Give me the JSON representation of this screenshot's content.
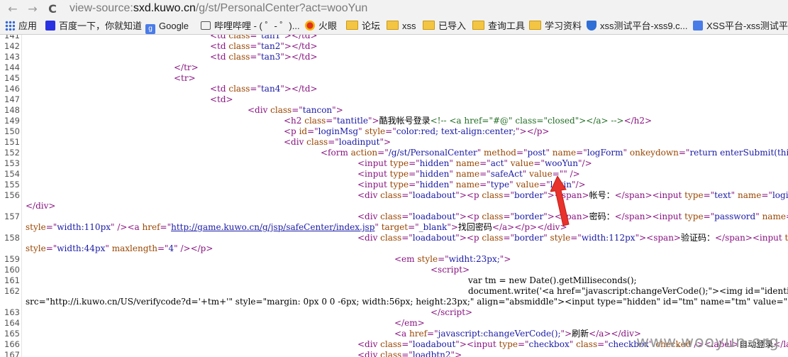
{
  "browser": {
    "url_scheme": "view-source:",
    "url_host": "sxd.kuwo.cn",
    "url_path": "/g/st/PersonalCenter?act=wooYun",
    "nav": {
      "back": "←",
      "forward": "→",
      "reload": "C"
    }
  },
  "bookmarks": [
    {
      "label": "应用",
      "icon": "apps-grid-icon"
    },
    {
      "label": "百度一下，你就知道",
      "icon": "baidu-icon"
    },
    {
      "label": "Google",
      "icon": "google-icon"
    },
    {
      "label": "哔哩哔哩 - ( ゜- ゜)...",
      "icon": "bilibili-icon"
    },
    {
      "label": "火眼",
      "icon": "huoyan-icon"
    },
    {
      "label": "论坛",
      "icon": "folder-icon"
    },
    {
      "label": "xss",
      "icon": "folder-icon"
    },
    {
      "label": "已导入",
      "icon": "folder-icon"
    },
    {
      "label": "查询工具",
      "icon": "folder-icon"
    },
    {
      "label": "学习资料",
      "icon": "folder-icon"
    },
    {
      "label": "xss测试平台-xss9.c...",
      "icon": "shield-icon"
    },
    {
      "label": "XSS平台-xss测试平",
      "icon": "xss-platform-icon"
    }
  ],
  "lines": [
    {
      "n": "141",
      "html": "<span class=\"t\">&lt;td </span><span class=\"a\">class</span><span class=\"t\">=\"</span><span class=\"v\">tan1</span><span class=\"t\">\"&gt;&lt;/td&gt;</span>"
    },
    {
      "n": "142",
      "html": "<span class=\"t\">&lt;td </span><span class=\"a\">class</span><span class=\"t\">=\"</span><span class=\"v\">tan2</span><span class=\"t\">\"&gt;&lt;/td&gt;</span>"
    },
    {
      "n": "143",
      "html": "<span class=\"t\">&lt;td </span><span class=\"a\">class</span><span class=\"t\">=\"</span><span class=\"v\">tan3</span><span class=\"t\">\"&gt;&lt;/td&gt;</span>"
    },
    {
      "n": "144",
      "html": "<span class=\"t\">&lt;/tr&gt;</span>"
    },
    {
      "n": "145",
      "html": "<span class=\"t\">&lt;tr&gt;</span>"
    },
    {
      "n": "146",
      "html": "<span class=\"t\">&lt;td </span><span class=\"a\">class</span><span class=\"t\">=\"</span><span class=\"v\">tan4</span><span class=\"t\">\"&gt;&lt;/td&gt;</span>"
    },
    {
      "n": "147",
      "html": "<span class=\"t\">&lt;td&gt;</span>"
    },
    {
      "n": "148",
      "html": "<span class=\"t\">&lt;div </span><span class=\"a\">class</span><span class=\"t\">=\"</span><span class=\"v\">tancon</span><span class=\"t\">\"&gt;</span>"
    },
    {
      "n": "149",
      "html": "<span class=\"t\">&lt;h2 </span><span class=\"a\">class</span><span class=\"t\">=\"</span><span class=\"v\">tantitle</span><span class=\"t\">\"&gt;</span>酷我帐号登录<span class=\"c\">&lt;!-- &lt;a href=\"#@\" class=\"closed\"&gt;&lt;/a&gt; --&gt;</span><span class=\"t\">&lt;/h2&gt;</span>"
    },
    {
      "n": "150",
      "html": "<span class=\"t\">&lt;p </span><span class=\"a\">id</span><span class=\"t\">=\"</span><span class=\"v\">loginMsg</span><span class=\"t\">\" </span><span class=\"a\">style</span><span class=\"t\">=\"</span><span class=\"v\">color:red; text-align:center;</span><span class=\"t\">\"&gt;&lt;/p&gt;</span>"
    },
    {
      "n": "151",
      "html": "<span class=\"t\">&lt;div </span><span class=\"a\">class</span><span class=\"t\">=\"</span><span class=\"v\">loadinput</span><span class=\"t\">\"&gt;</span>"
    },
    {
      "n": "152",
      "html": "<span class=\"t\">&lt;form </span><span class=\"a\">action</span><span class=\"t\">=\"</span><span class=\"v\">/g/st/PersonalCenter</span><span class=\"t\">\" </span><span class=\"a\">method</span><span class=\"t\">=\"</span><span class=\"v\">post</span><span class=\"t\">\" </span><span class=\"a\">name</span><span class=\"t\">=\"</span><span class=\"v\">logForm</span><span class=\"t\">\" </span><span class=\"a\">onkeydown</span><span class=\"t\">=\"</span><span class=\"v\">return enterSubmit(this, e</span>"
    },
    {
      "n": "153",
      "html": "<span class=\"t\">&lt;input </span><span class=\"a\">type</span><span class=\"t\">=\"</span><span class=\"v\">hidden</span><span class=\"t\">\" </span><span class=\"a\">name</span><span class=\"t\">=\"</span><span class=\"v\">act</span><span class=\"t\">\" </span><span class=\"a\">value</span><span class=\"t\">=\"</span><span class=\"v\">wooYun</span><span class=\"t\">\"/&gt;</span>"
    },
    {
      "n": "154",
      "html": "<span class=\"t\">&lt;input </span><span class=\"a\">type</span><span class=\"t\">=\"</span><span class=\"v\">hidden</span><span class=\"t\">\" </span><span class=\"a\">name</span><span class=\"t\">=\"</span><span class=\"v\">safeAct</span><span class=\"t\">\" </span><span class=\"a\">value</span><span class=\"t\">=\"\" /&gt;</span>"
    },
    {
      "n": "155",
      "html": "<span class=\"t\">&lt;input </span><span class=\"a\">type</span><span class=\"t\">=\"</span><span class=\"v\">hidden</span><span class=\"t\">\" </span><span class=\"a\">name</span><span class=\"t\">=\"</span><span class=\"v\">type</span><span class=\"t\">\" </span><span class=\"a\">value</span><span class=\"t\">=\"</span><span class=\"v\">login</span><span class=\"t\">\"/&gt;</span>"
    },
    {
      "n": "156",
      "html": "<span class=\"t\">&lt;div </span><span class=\"a\">class</span><span class=\"t\">=\"</span><span class=\"v\">loadabout</span><span class=\"t\">\"&gt;&lt;p </span><span class=\"a\">class</span><span class=\"t\">=\"</span><span class=\"v\">border</span><span class=\"t\">\"&gt;&lt;span&gt;</span>帐号：<span class=\"t\">&lt;/span&gt;&lt;input </span><span class=\"a\">type</span><span class=\"t\">=\"</span><span class=\"v\">text</span><span class=\"t\">\" </span><span class=\"a\">name</span><span class=\"t\">=\"</span><span class=\"v\">loginName</span>"
    },
    {
      "n": "",
      "html": "<span class=\"t\">&lt;/div&gt;</span>"
    },
    {
      "n": "157",
      "html": "<span class=\"t\">&lt;div </span><span class=\"a\">class</span><span class=\"t\">=\"</span><span class=\"v\">loadabout</span><span class=\"t\">\"&gt;&lt;p </span><span class=\"a\">class</span><span class=\"t\">=\"</span><span class=\"v\">border</span><span class=\"t\">\"&gt;&lt;span&gt;</span>密码：<span class=\"t\">&lt;/span&gt;&lt;input </span><span class=\"a\">type</span><span class=\"t\">=\"</span><span class=\"v\">password</span><span class=\"t\">\" </span><span class=\"a\">name</span><span class=\"t\">=\"</span><span class=\"v\">loginP</span>"
    },
    {
      "n": "",
      "html": "<span class=\"a\">style</span><span class=\"t\">=\"</span><span class=\"v\">width:110px</span><span class=\"t\">\" /&gt;&lt;a </span><span class=\"a\">href</span><span class=\"t\">=\"</span><span class=\"link\">http://game.kuwo.cn/g/jsp/safeCenter/index.jsp</span><span class=\"t\">\" </span><span class=\"a\">target</span><span class=\"t\">=\"</span><span class=\"v\">_blank</span><span class=\"t\">\"&gt;</span>找回密码<span class=\"t\">&lt;/a&gt;&lt;/p&gt;&lt;/div&gt;</span>"
    },
    {
      "n": "158",
      "html": "<span class=\"t\">&lt;div </span><span class=\"a\">class</span><span class=\"t\">=\"</span><span class=\"v\">loadabout</span><span class=\"t\">\"&gt;&lt;p </span><span class=\"a\">class</span><span class=\"t\">=\"</span><span class=\"v\">border</span><span class=\"t\">\" </span><span class=\"a\">style</span><span class=\"t\">=\"</span><span class=\"v\">width:112px</span><span class=\"t\">\"&gt;&lt;span&gt;</span>验证码：<span class=\"t\">&lt;/span&gt;&lt;input </span><span class=\"a\">type</span><span class=\"t\">=\"</span>"
    },
    {
      "n": "",
      "html": "<span class=\"a\">style</span><span class=\"t\">=\"</span><span class=\"v\">width:44px</span><span class=\"t\">\" </span><span class=\"a\">maxlength</span><span class=\"t\">=\"</span><span class=\"v\">4</span><span class=\"t\">\" /&gt;&lt;/p&gt;</span>"
    },
    {
      "n": "159",
      "html": "<span class=\"t\">&lt;em </span><span class=\"a\">style</span><span class=\"t\">=\"</span><span class=\"v\">widht:23px;</span><span class=\"t\">\"&gt;</span>"
    },
    {
      "n": "160",
      "html": "<span class=\"t\">&lt;script&gt;</span>"
    },
    {
      "n": "161",
      "html": "var tm = new Date().getMilliseconds();"
    },
    {
      "n": "162",
      "html": "document.write('&lt;a href=\"javascript:changeVerCode();\"&gt;&lt;img id=\"identi"
    },
    {
      "n": "",
      "html": "src=\"http://i.kuwo.cn/US/verifycode?d='+tm+'\" style=\"margin: 0px 0 0 -6px; width:56px; height:23px;\" align=\"absmiddle\"&gt;&lt;input type=\"hidden\" id=\"tm\" name=\"tm\" value=\""
    },
    {
      "n": "163",
      "html": "<span class=\"t\">&lt;/script&gt;</span>"
    },
    {
      "n": "164",
      "html": "<span class=\"t\">&lt;/em&gt;</span>"
    },
    {
      "n": "165",
      "html": "<span class=\"t\">&lt;a </span><span class=\"a\">href</span><span class=\"t\">=\"</span><span class=\"v\">javascript:changeVerCode();</span><span class=\"t\">\"&gt;</span>刷新<span class=\"t\">&lt;/a&gt;&lt;/div&gt;</span>"
    },
    {
      "n": "166",
      "html": "<span class=\"t\">&lt;div </span><span class=\"a\">class</span><span class=\"t\">=\"</span><span class=\"v\">loadabout</span><span class=\"t\">\"&gt;&lt;input </span><span class=\"a\">type</span><span class=\"t\">=\"</span><span class=\"v\">checkbox</span><span class=\"t\">\" </span><span class=\"a\">class</span><span class=\"t\">=\"</span><span class=\"v\">checkbox</span><span class=\"t\">\" </span><span class=\"a\">checked</span><span class=\"t\"> /&gt;&lt;label&gt;</span>自动登录<span class=\"t\">&lt;/lab</span>"
    },
    {
      "n": "167",
      "html": "<span class=\"t\">&lt;div </span><span class=\"a\">class</span><span class=\"t\">=\"</span><span class=\"v\">loadbtn2</span><span class=\"t\">\"&gt;</span>"
    }
  ],
  "watermark": "www.wooyun.org"
}
